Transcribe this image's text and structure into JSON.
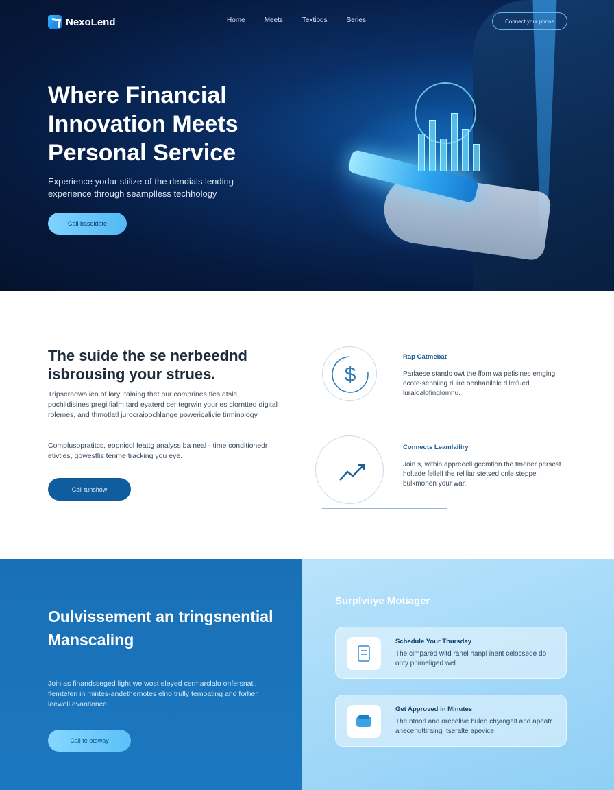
{
  "brand": {
    "name": "NexoLend"
  },
  "nav": {
    "links": [
      "Home",
      "Meets",
      "Textiods",
      "Series"
    ],
    "cta": "Connect your phone"
  },
  "hero": {
    "title": "Where Financial Innovation Meets Personal Service",
    "subtitle": "Experience yodar stilize of the rlendials lending experience through seamplless techhology",
    "button": "Call baseldate"
  },
  "section2": {
    "title": "The suide the se nerbeednd isbrousing your strues.",
    "para1": "Tripseradwalien of lary Italaing thet bur comprines tles atsle, pochildisines pregilfialm tard eyaterd cer tegrwin your es clorntted digital rolemes, and thmotlatl jurocraipochlange powericalivie tirminology.",
    "para2": "Complusopratitcs, eopnicol feattg analyss ba neal - time conditionedr etivties, gowestlis tenme tracking you eye.",
    "button": "Call tunshow",
    "features": [
      {
        "icon": "dollar-icon",
        "title": "Rap Catmebat",
        "desc": "Parlaese stands owt the ffom wa pefisines emging ecote-senniing riuire oenhanilele dilmfued luraloalofinglomnu."
      },
      {
        "icon": "trend-up-icon",
        "title": "Connects Leamlailiry",
        "desc": "Join s, within appreeell gecmtion the tmener persest holtade fellelf the reliliar stetsed onle steppe bulkmonen your war."
      }
    ]
  },
  "section3": {
    "title": "Oulvissement an tringsnential Manscaling",
    "para": "Join as finandsseged light we wost eleyed cermarclalo onfersnatl, flemtefen in mintes-andethemotes elno trully temoating and forher leewoli evantionce.",
    "button": "Call te otoway",
    "right_title": "Surplviiye Motiager",
    "cards": [
      {
        "icon": "document-icon",
        "title": "Schedule Your Thursday",
        "desc": "The cimpared witd ranel hanpl inent celocsede do onty phimeliged wel."
      },
      {
        "icon": "wallet-icon",
        "title": "Get Approved in Minutes",
        "desc": "The ntoorl and orecelive buled chyrogelt and apeatr anecenuttiraing Itseralte apevice."
      }
    ]
  },
  "colors": {
    "hero_bg": "#061a3f",
    "accent": "#53b9f4",
    "primary_button": "#0f5d9c",
    "section3_left": "#1b78c0",
    "section3_right": "#b9e3fb"
  }
}
